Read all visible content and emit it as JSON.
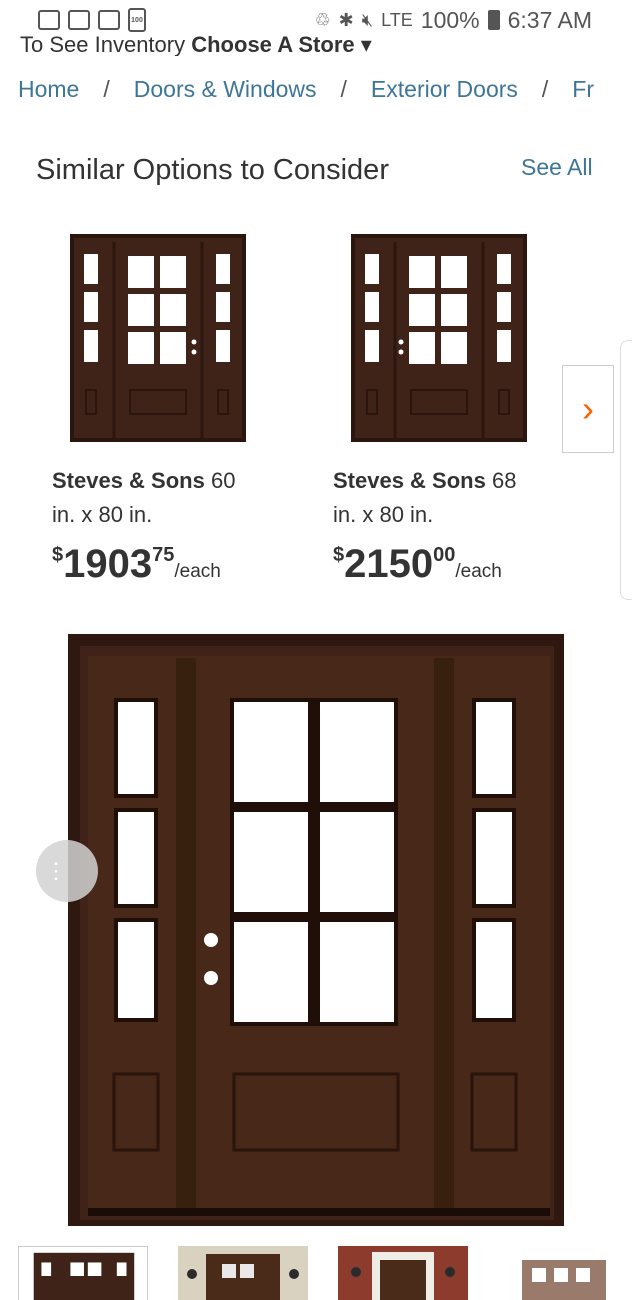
{
  "status_bar": {
    "battery_icon_label": "100",
    "battery_percent": "100%",
    "time": "6:37 AM",
    "network": "LTE"
  },
  "store_strip": {
    "prefix": "To See Inventory",
    "link": "Choose A Store"
  },
  "breadcrumb": [
    "Home",
    "Doors & Windows",
    "Exterior Doors",
    "Fr"
  ],
  "similar": {
    "title": "Similar Options to Consider",
    "see_all": "See All",
    "items": [
      {
        "brand": "Steves & Sons",
        "desc_line1": " 60",
        "desc_line2": "in. x 80 in.",
        "currency": "$",
        "dollars": "1903",
        "cents": "75",
        "unit": "/each",
        "handle_side": "right"
      },
      {
        "brand": "Steves & Sons",
        "desc_line1": " 68",
        "desc_line2": "in. x 80 in.",
        "currency": "$",
        "dollars": "2150",
        "cents": "00",
        "unit": "/each",
        "handle_side": "left"
      }
    ]
  },
  "icons": {
    "next": "chevron-right-icon",
    "scroll_handle": "vertical-dots-icon"
  },
  "colors": {
    "link": "#3e7697",
    "accent": "#f96302",
    "door_wood": "#3f2318"
  }
}
